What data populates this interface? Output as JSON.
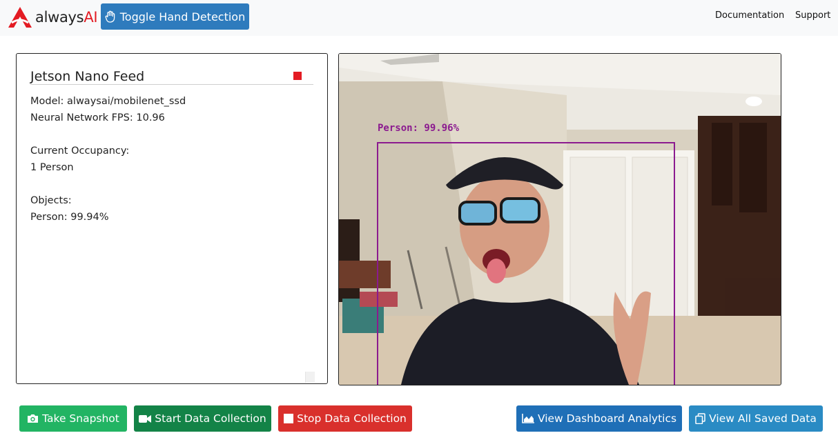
{
  "header": {
    "logo_text_part1": "always",
    "logo_text_part2": "AI",
    "toggle_button": "Toggle Hand Detection",
    "nav": {
      "documentation": "Documentation",
      "support": "Support"
    }
  },
  "card": {
    "title": "Jetson Nano Feed",
    "model": "Model: alwaysai/mobilenet_ssd",
    "fps": "Neural Network FPS: 10.96",
    "occupancy_label": "Current Occupancy:",
    "occupancy_value": "1 Person",
    "objects_label": "Objects:",
    "objects_value": "Person: 99.94%"
  },
  "feed": {
    "detection_label": "Person: 99.96%"
  },
  "buttons": {
    "snapshot": "Take Snapshot",
    "start": "Start Data Collection",
    "stop": "Stop Data Collection",
    "dashboard": "View Dashboard Analytics",
    "saved": "View All Saved Data"
  },
  "colors": {
    "brand_red": "#e31b23",
    "toggle_blue": "#2e7bbd",
    "snapshot_green": "#22b463",
    "start_green": "#138347",
    "stop_red": "#d9302c",
    "dashboard_blue": "#1f6fb7",
    "saved_blue": "#2a8bc4",
    "bbox_purple": "#8b1a8f"
  },
  "icons": {
    "logo": "alwaysai-logo-icon",
    "toggle": "hand-icon",
    "snapshot": "camera-icon",
    "start": "video-camera-icon",
    "stop": "stop-square-icon",
    "dashboard": "area-chart-icon",
    "saved": "copy-icon"
  }
}
